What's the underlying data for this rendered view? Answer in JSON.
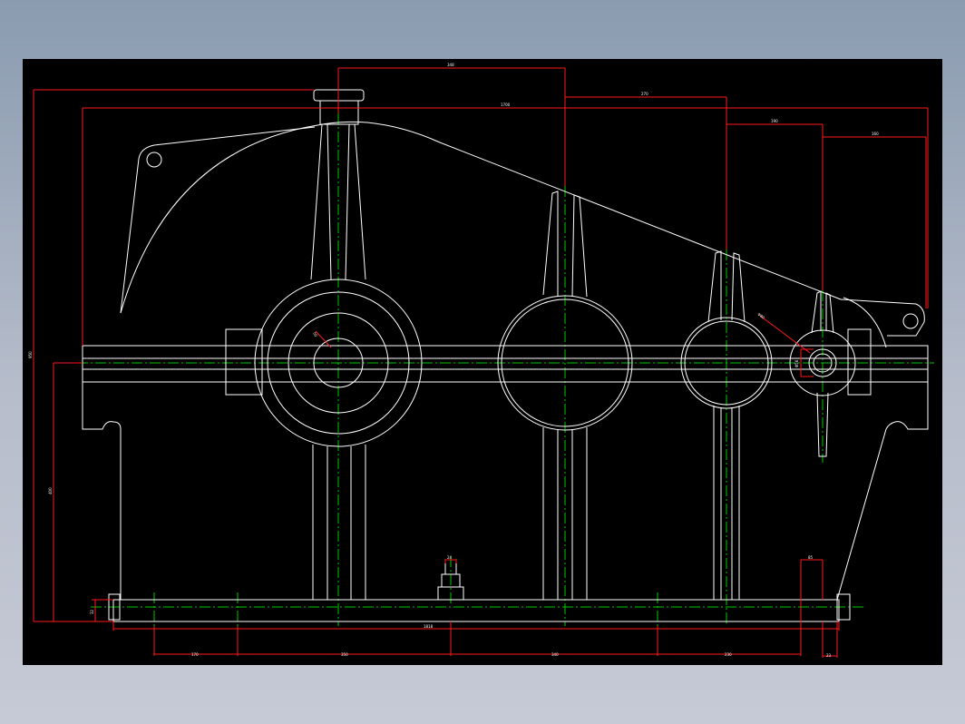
{
  "colors": {
    "background": "#000000",
    "outline": "#ffffff",
    "dimension": "#ff1a1a",
    "centerline": "#00c800"
  },
  "dimensions": {
    "top_shaft": "348",
    "overall_top": "1700",
    "center_2_3": "270",
    "center_3_4": "190",
    "end_right": "160",
    "input_bore": "50",
    "output_bore": "Φ80",
    "input_shaft": "Φ56",
    "total_height": "950",
    "center_height": "400",
    "base_thickness": "32",
    "drain_plug": "24",
    "right_foot": "85",
    "base_length": "1818",
    "foot_1": "170",
    "foot_2": "350",
    "foot_3": "340",
    "foot_4": "230",
    "foot_end": "23"
  }
}
